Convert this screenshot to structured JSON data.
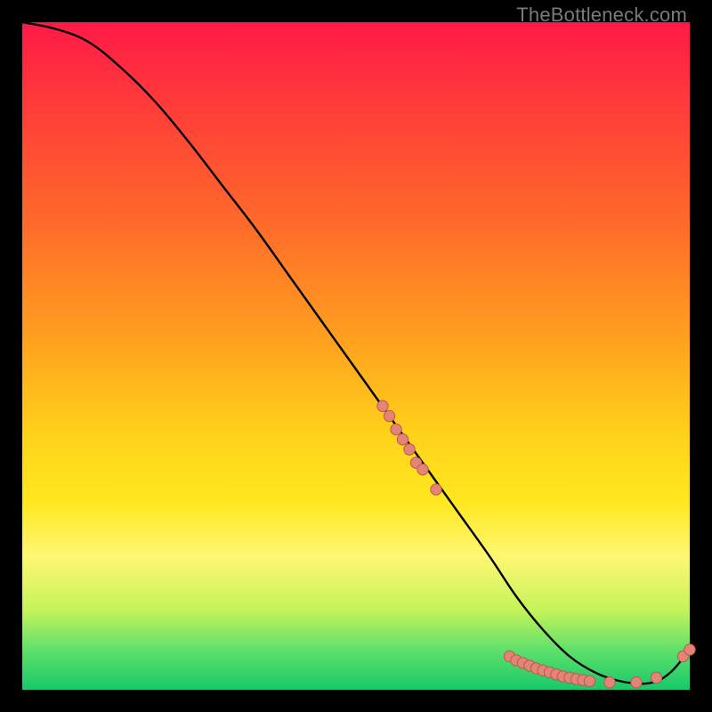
{
  "watermark": {
    "text": "TheBottleneck.com"
  },
  "colors": {
    "curve": "#000000",
    "marker_fill": "#e38477",
    "marker_stroke": "#b85a4c",
    "black_bg": "#000000"
  },
  "chart_data": {
    "type": "line",
    "title": "",
    "xlabel": "",
    "ylabel": "",
    "xlim": [
      0,
      100
    ],
    "ylim": [
      0,
      100
    ],
    "grid": false,
    "legend": false,
    "series": [
      {
        "name": "curve",
        "x": [
          0,
          5,
          10,
          15,
          20,
          25,
          30,
          35,
          40,
          45,
          50,
          55,
          60,
          65,
          70,
          74,
          78,
          82,
          86,
          90,
          94,
          97,
          100
        ],
        "values": [
          100,
          99,
          97,
          93,
          88,
          82,
          75.5,
          69,
          62,
          55,
          48,
          41,
          34,
          27,
          20,
          14,
          9,
          5,
          2.5,
          1.2,
          1.0,
          2.5,
          6
        ]
      }
    ],
    "markers": [
      {
        "x": 54,
        "y": 42.5
      },
      {
        "x": 55,
        "y": 41.0
      },
      {
        "x": 56,
        "y": 39.0
      },
      {
        "x": 57,
        "y": 37.5
      },
      {
        "x": 58,
        "y": 36.0
      },
      {
        "x": 59,
        "y": 34.0
      },
      {
        "x": 60,
        "y": 33.0
      },
      {
        "x": 62,
        "y": 30.0
      },
      {
        "x": 73,
        "y": 5.0
      },
      {
        "x": 74,
        "y": 4.4
      },
      {
        "x": 75,
        "y": 4.0
      },
      {
        "x": 76,
        "y": 3.6
      },
      {
        "x": 77,
        "y": 3.2
      },
      {
        "x": 78,
        "y": 2.9
      },
      {
        "x": 79,
        "y": 2.6
      },
      {
        "x": 80,
        "y": 2.3
      },
      {
        "x": 81,
        "y": 2.0
      },
      {
        "x": 82,
        "y": 1.8
      },
      {
        "x": 83,
        "y": 1.6
      },
      {
        "x": 84,
        "y": 1.45
      },
      {
        "x": 85,
        "y": 1.3
      },
      {
        "x": 88,
        "y": 1.1
      },
      {
        "x": 92,
        "y": 1.1
      },
      {
        "x": 95,
        "y": 1.8
      },
      {
        "x": 99,
        "y": 5.0
      },
      {
        "x": 100,
        "y": 6.0
      }
    ]
  }
}
